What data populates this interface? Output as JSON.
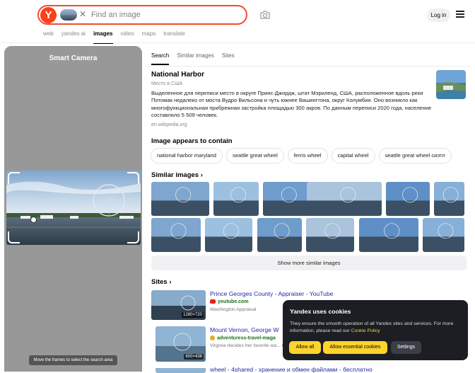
{
  "header": {
    "logo_letter": "Y",
    "search_placeholder": "Find an image",
    "login_label": "Log in",
    "nav_tabs": [
      "web",
      "yandex ai",
      "images",
      "video",
      "maps",
      "translate"
    ],
    "active_nav": "images"
  },
  "smart_camera": {
    "title": "Smart Camera",
    "hint": "Move the frames to select the search area"
  },
  "results_tabs": [
    "Search",
    "Similar images",
    "Sites"
  ],
  "entity": {
    "title": "National Harbor",
    "subtitle": "Место в США",
    "description": "Выделенное для переписи место в округе Принс-Джордж, штат Мэриленд, США, расположенное вдоль реки Потомак недалеко от моста Вудро Вильсона и чуть южнее Вашингтона, округ Колумбия. Оно возникло как многофункциональная прибрежная застройка площадью 300 акров. По данным переписи 2020 года, население составляло 5 509 человек.",
    "source": "en.wikipedia.org"
  },
  "contains": {
    "title": "Image appears to contain",
    "chips": [
      "national harbor maryland",
      "seattle great wheel",
      "ferris wheel",
      "capital wheel",
      "seattle great wheel сиэтл"
    ]
  },
  "similar": {
    "title": "Similar images",
    "show_more": "Show more similar images"
  },
  "sites": {
    "title": "Sites",
    "items": [
      {
        "title": "Prince Georges County - Appraiser - YouTube",
        "url": "youtube.com",
        "desc": "Washington Appraisal",
        "size": "1280×720"
      },
      {
        "title": "Mount Vernon, George W",
        "url": "adventuress-travel-maga",
        "desc": "Virginia decides her favorite wa... have traveled in plantation times",
        "size": "600×436"
      },
      {
        "title": "wheel - 4shared - хранение и обмен файлами - бесплатно",
        "url": "",
        "desc": "",
        "size": ""
      }
    ]
  },
  "cookie": {
    "title": "Yandex uses cookies",
    "text": "They ensure the smooth operation of all Yandex sites and services. For more information, please read our",
    "link": "Cookie Policy",
    "allow_all": "Allow all",
    "allow_essential": "Allow essential cookies",
    "settings": "Settings"
  },
  "colors": {
    "brand": "#fc3f1d",
    "accent_yellow": "#fed42b",
    "link": "#2228a8"
  },
  "icons": [
    "yandex-logo-icon",
    "close-icon",
    "camera-icon",
    "menu-icon",
    "chevron-right-icon",
    "youtube-icon"
  ]
}
